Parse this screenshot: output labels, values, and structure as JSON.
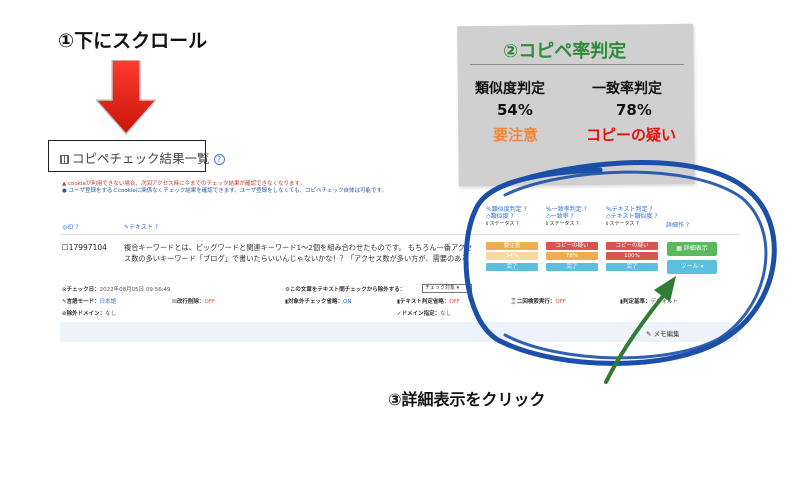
{
  "annotations": {
    "step1": "①下にスクロール",
    "step2_title": "②コピペ率判定",
    "step2_similarity_label": "類似度判定",
    "step2_similarity_value": "54%",
    "step2_similarity_status": "要注意",
    "step2_match_label": "一致率判定",
    "step2_match_value": "78%",
    "step2_match_status": "コピーの疑い",
    "step3": "③詳細表示をクリック"
  },
  "panel": {
    "title": "コピペチェック結果一覧",
    "help": "?",
    "note_cookie": "▲ cookieが利用できない場合、次回アクセス時に今までのチェック結果が確認できなくなります。",
    "note_register": "● ユーザ登録をするとcookieに関係なくチェック結果を確認できます。ユーザ登録をしなくても、コピペチェック自体は可能です。"
  },
  "table": {
    "col_id": "◎ID ?",
    "col_text": "✎テキスト ?",
    "col1": [
      "%類似度判定 ?",
      "◇類似度 ?",
      "ℹ ステータス ?"
    ],
    "col2": [
      "%一致率判定 ?",
      "◇一致率 ?",
      "ℹ ステータス ?"
    ],
    "col3": [
      "%テキスト判定 ?",
      "◇テキスト類似度 ?",
      "ℹ ステータス ?"
    ],
    "col_op": "詳細作 ?",
    "row": {
      "id": "☐17997104",
      "text": "複合キーワードとは、ビッグワードと関連キーワード1〜2個を組み合わせたものです。 もちろん一番アクセス数の多いキーワード「ブログ」で書いたらいいんじゃないかな！？「アクセス数が多い方が、需要のあるキ...",
      "sim_status": "要注意",
      "sim_value": "54%",
      "sim_done": "完了",
      "match_status": "コピーの疑い",
      "match_value": "78%",
      "match_done": "完了",
      "text_status": "コピーの疑い",
      "text_value": "100%",
      "text_done": "完了",
      "detail_button": "▦ 詳細表示",
      "tool_button": "ツール ▾"
    }
  },
  "meta": {
    "check_date_label": "⊙チェック日：",
    "check_date_value": "2022年08月05日 09:56:49",
    "lang_label": "✎言語モード：",
    "lang_value": "日本語",
    "line_del_label": "☒改行削除：",
    "line_del_value": "OFF",
    "exclude_label": "⊘除外ドメイン：",
    "exclude_value": "なし",
    "text_search_label": "⚙この文章をテキスト間チェックから除外する：",
    "text_search_select": "チェック対象 ▾",
    "block_label": "▮対象外チェック省略：",
    "block_value": "ON",
    "text_skip_label": "▮テキスト判定省略：",
    "text_skip_value": "OFF",
    "domain_label": "✓ドメイン指定：",
    "domain_value": "なし",
    "twice_label": "⌛二回検索実行：",
    "twice_value": "OFF",
    "judge_label": "▮判定基準：",
    "judge_value": "デフォルト",
    "edit": "✎ メモ編集"
  },
  "colors": {
    "orange": "#f0ad4e",
    "red": "#d9534f",
    "teal": "#5bc0de",
    "green": "#5cb85c",
    "blue_ring": "#1b4fa8",
    "green_arrow": "#2e7d32",
    "arrow_red": "#e8291c"
  }
}
